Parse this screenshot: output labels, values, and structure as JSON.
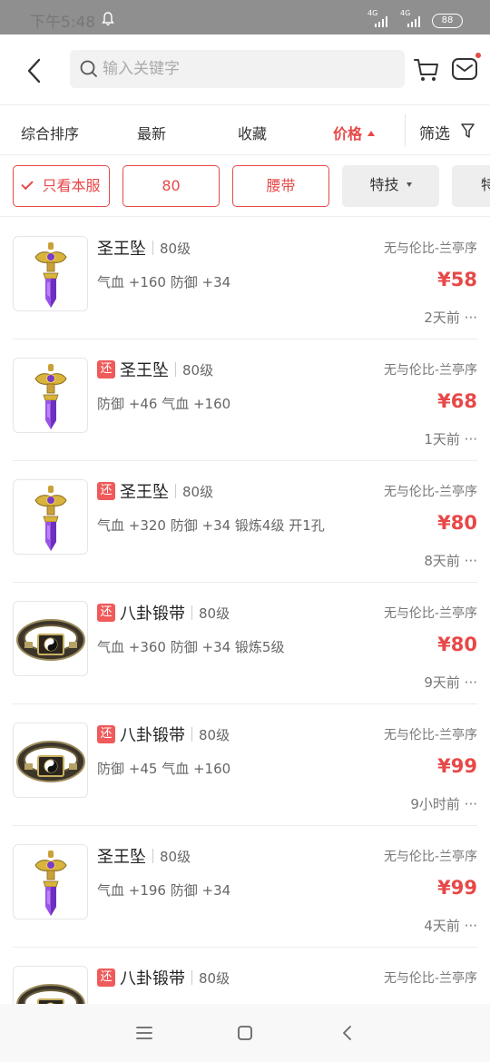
{
  "status_bar": {
    "time": "下午5:48",
    "battery": "88",
    "signal1_label": "4G",
    "signal2_label": "4G"
  },
  "search": {
    "placeholder": "输入关键字"
  },
  "sort_bar": {
    "items": [
      "综合排序",
      "最新",
      "收藏",
      "价格"
    ],
    "filter_label": "筛选"
  },
  "chips": [
    {
      "label": "只看本服",
      "style": "selected"
    },
    {
      "label": "80",
      "style": "selected"
    },
    {
      "label": "腰带",
      "style": "selected"
    },
    {
      "label": "特技",
      "style": "dropdown"
    },
    {
      "label": "特",
      "style": "dropdown"
    }
  ],
  "listings": [
    {
      "tag": "",
      "name": "圣王坠",
      "level": "80级",
      "server": "无与伦比-兰亭序",
      "attrs": "气血 +160 防御 +34",
      "price": "¥58",
      "time": "2天前 ···",
      "image": "pendant-image"
    },
    {
      "tag": "还",
      "name": "圣王坠",
      "level": "80级",
      "server": "无与伦比-兰亭序",
      "attrs": "防御 +46 气血 +160",
      "price": "¥68",
      "time": "1天前 ···",
      "image": "pendant-image"
    },
    {
      "tag": "还",
      "name": "圣王坠",
      "level": "80级",
      "server": "无与伦比-兰亭序",
      "attrs": "气血 +320 防御 +34 锻炼4级 开1孔",
      "price": "¥80",
      "time": "8天前 ···",
      "image": "pendant-image"
    },
    {
      "tag": "还",
      "name": "八卦锻带",
      "level": "80级",
      "server": "无与伦比-兰亭序",
      "attrs": "气血 +360 防御 +34 锻炼5级",
      "price": "¥80",
      "time": "9天前 ···",
      "image": "belt-image"
    },
    {
      "tag": "还",
      "name": "八卦锻带",
      "level": "80级",
      "server": "无与伦比-兰亭序",
      "attrs": "防御 +45 气血 +160",
      "price": "¥99",
      "time": "9小时前 ···",
      "image": "belt-image"
    },
    {
      "tag": "",
      "name": "圣王坠",
      "level": "80级",
      "server": "无与伦比-兰亭序",
      "attrs": "气血 +196 防御 +34",
      "price": "¥99",
      "time": "4天前 ···",
      "image": "pendant-image"
    },
    {
      "tag": "还",
      "name": "八卦锻带",
      "level": "80级",
      "server": "无与伦比-兰亭序",
      "attrs": "",
      "price": "",
      "time": "",
      "image": "belt-image"
    }
  ],
  "colors": {
    "accent": "#e84848",
    "tag_bg": "#ef5a5a",
    "status_bar": "#8f8f8f"
  },
  "icons": {
    "back": "chevron-left-icon",
    "search": "search-icon",
    "cart": "cart-icon",
    "mail": "mail-icon",
    "filter": "funnel-icon",
    "nav_menu": "menu-icon",
    "nav_home": "square-home-icon",
    "nav_back": "back-icon"
  }
}
